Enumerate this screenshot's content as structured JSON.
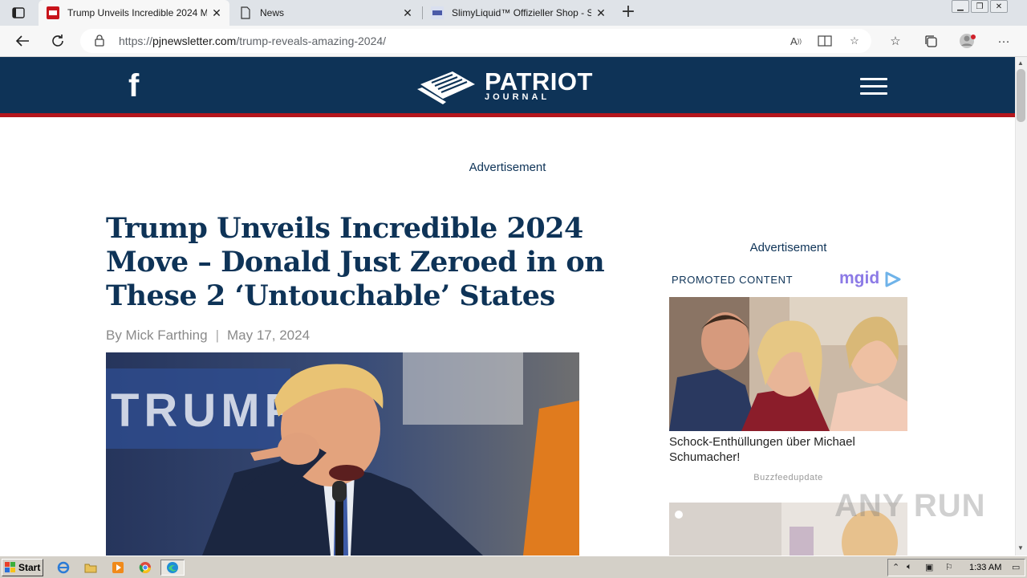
{
  "browser": {
    "tabs": [
      {
        "title": "Trump Unveils Incredible 2024 Mo",
        "active": true
      },
      {
        "title": "News",
        "active": false
      },
      {
        "title": "SlimyLiquid™ Offizieller Shop - Sl",
        "active": false
      }
    ],
    "url": {
      "scheme": "https://",
      "host": "pjnewsletter.com",
      "path": "/trump-reveals-amazing-2024/"
    }
  },
  "site": {
    "brand_main": "PATRIOT",
    "brand_sub": "JOURNAL",
    "colors": {
      "header": "#0e3357",
      "accent": "#b5161c"
    }
  },
  "article": {
    "ad_label": "Advertisement",
    "headline": "Trump Unveils Incredible 2024 Move – Donald Just Zeroed in on These 2 ‘Untouchable’ States",
    "author": "By Mick Farthing",
    "separator": "|",
    "date": "May 17, 2024"
  },
  "sidebar": {
    "ad_label": "Advertisement",
    "promo_label": "PROMOTED CONTENT",
    "network": "mgid",
    "items": [
      {
        "title": "Schock-Enthüllungen über Michael Schumacher!",
        "source": "Buzzfeedupdate"
      }
    ]
  },
  "watermark": "ANY RUN",
  "taskbar": {
    "start_label": "Start",
    "clock": "1:33 AM"
  }
}
